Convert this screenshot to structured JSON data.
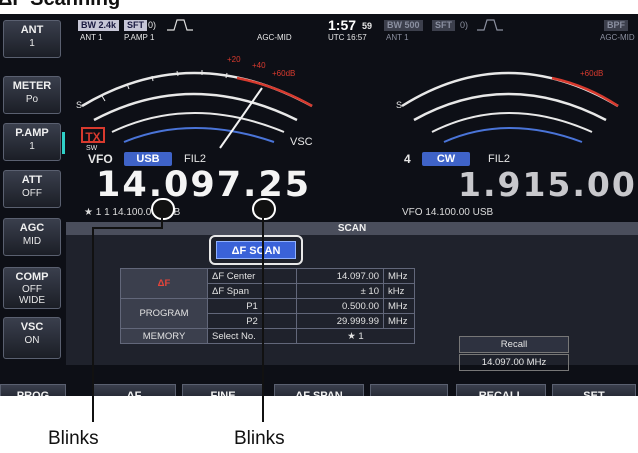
{
  "heading": "ΔF Scanning",
  "left_buttons": [
    {
      "label": "ANT",
      "value": "1"
    },
    {
      "label": "METER",
      "value": "Po"
    },
    {
      "label": "P.AMP",
      "value": "1"
    },
    {
      "label": "ATT",
      "value": "OFF"
    },
    {
      "label": "AGC",
      "value": "MID"
    },
    {
      "label": "COMP",
      "value": "OFF WIDE"
    },
    {
      "label": "VSC",
      "value": "ON"
    }
  ],
  "status": {
    "bw_main": "BW 2.4k",
    "sft_main": "SFT",
    "sft_main_val": "0)",
    "ant_main": "ANT 1",
    "pamp_main": "P.AMP 1",
    "agc_main": "AGC-MID",
    "clock": "1:57",
    "seconds": "59",
    "utc": "UTC 16:57",
    "bw_sub": "BW 500",
    "sft_sub": "SFT",
    "sft_sub_val": "0)",
    "bpf": "BPF",
    "ant_sub": "ANT 1",
    "agc_sub": "AGC-MID"
  },
  "meter_main": {
    "tx": "TX",
    "vsc": "VSC"
  },
  "vfo_main": {
    "label": "VFO",
    "mode": "USB",
    "filter": "FIL2",
    "freq": "14.097.25",
    "memline": "★ 1  1 14.100.00 USB"
  },
  "vfo_sub": {
    "index": "4",
    "mode": "CW",
    "filter": "FIL2",
    "freq": "1.915.00",
    "memline": "VFO  14.100.00 USB"
  },
  "scan": {
    "title": "SCAN",
    "button": "ΔF SCAN",
    "rows": [
      {
        "head": "ΔF",
        "label": "ΔF  Center",
        "value": "14.097.00",
        "unit": "MHz"
      },
      {
        "head": "",
        "label": "ΔF  Span",
        "value": "±   10",
        "unit": "kHz"
      },
      {
        "head": "PROGRAM",
        "label": "P1",
        "value": "0.500.00",
        "unit": "MHz"
      },
      {
        "head": "",
        "label": "P2",
        "value": "29.999.99",
        "unit": "MHz"
      },
      {
        "head": "MEMORY",
        "label": "Select No.",
        "value": "★ 1",
        "unit": ""
      }
    ],
    "recall_label": "Recall",
    "recall_value": "14.097.00  MHz"
  },
  "function_keys": [
    "PROG",
    "ΔF",
    "FINE",
    "ΔF SPAN",
    "",
    "RECALL",
    "SET"
  ],
  "callouts": [
    "Blinks",
    "Blinks"
  ],
  "colors": {
    "accent_blue": "#3f63c8",
    "tx_red": "#d83a2e",
    "bg": "#0d0f16"
  }
}
